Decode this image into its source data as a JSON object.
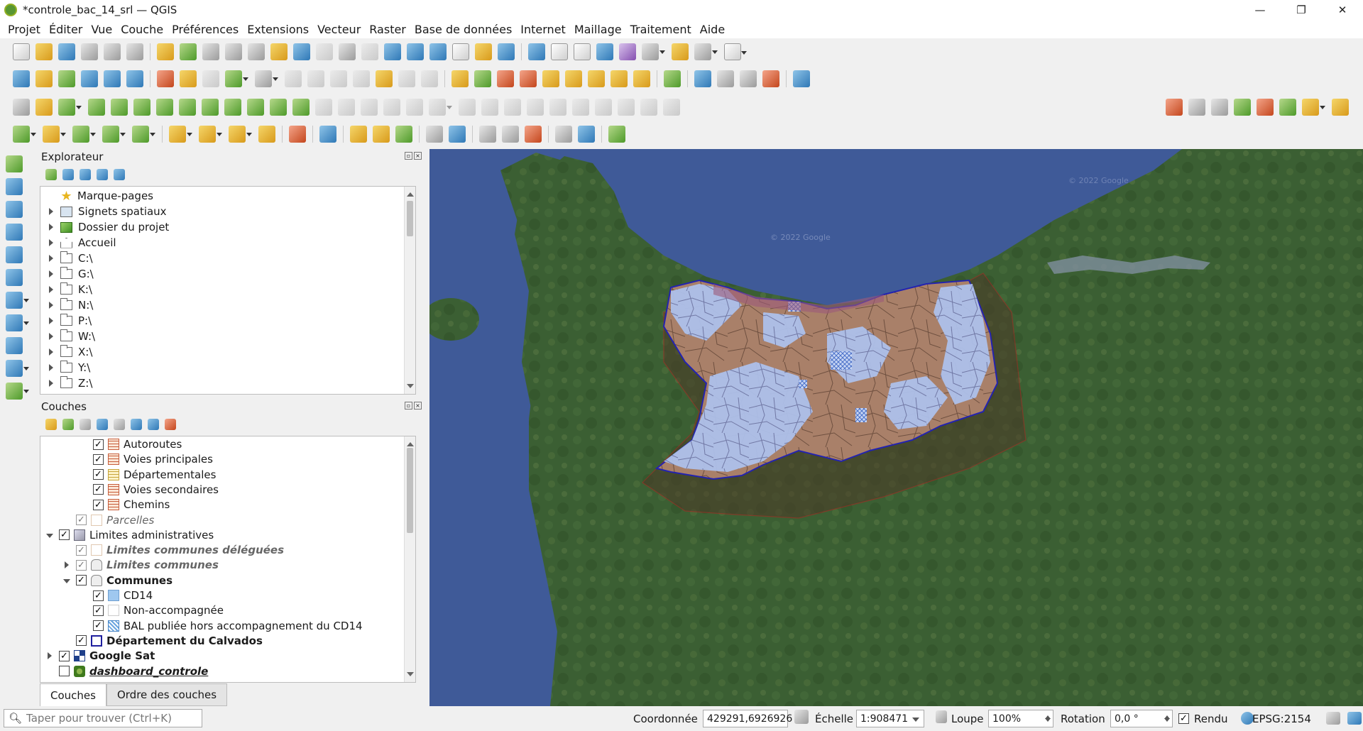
{
  "window": {
    "title": "*controle_bac_14_srl — QGIS",
    "controls": [
      "—",
      "❐",
      "✕"
    ]
  },
  "menu": [
    "Projet",
    "Éditer",
    "Vue",
    "Couche",
    "Préférences",
    "Extensions",
    "Vecteur",
    "Raster",
    "Base de données",
    "Internet",
    "Maillage",
    "Traitement",
    "Aide"
  ],
  "explorer": {
    "title": "Explorateur",
    "items": [
      {
        "label": "Marque-pages",
        "icon": "star-icon",
        "expand": false
      },
      {
        "label": "Signets spatiaux",
        "icon": "bookmark-icon",
        "expand": true
      },
      {
        "label": "Dossier du projet",
        "icon": "project-folder-icon",
        "expand": true
      },
      {
        "label": "Accueil",
        "icon": "home-icon",
        "expand": true
      },
      {
        "label": "C:\\",
        "icon": "folder-icon",
        "expand": true
      },
      {
        "label": "G:\\",
        "icon": "folder-icon",
        "expand": true
      },
      {
        "label": "K:\\",
        "icon": "folder-icon",
        "expand": true
      },
      {
        "label": "N:\\",
        "icon": "folder-icon",
        "expand": true
      },
      {
        "label": "P:\\",
        "icon": "folder-icon",
        "expand": true
      },
      {
        "label": "W:\\",
        "icon": "folder-icon",
        "expand": true
      },
      {
        "label": "X:\\",
        "icon": "folder-icon",
        "expand": true
      },
      {
        "label": "Y:\\",
        "icon": "folder-icon",
        "expand": true
      },
      {
        "label": "Z:\\",
        "icon": "folder-icon",
        "expand": true
      }
    ]
  },
  "layers": {
    "title": "Couches",
    "items": [
      {
        "label": "Autoroutes",
        "checked": true,
        "sym": "sym-road",
        "indent": 3,
        "style": "",
        "arrow": ""
      },
      {
        "label": "Voies principales",
        "checked": true,
        "sym": "sym-road",
        "indent": 3,
        "style": "",
        "arrow": ""
      },
      {
        "label": "Départementales",
        "checked": true,
        "sym": "sym-road2",
        "indent": 3,
        "style": "",
        "arrow": ""
      },
      {
        "label": "Voies secondaires",
        "checked": true,
        "sym": "sym-road",
        "indent": 3,
        "style": "",
        "arrow": ""
      },
      {
        "label": "Chemins",
        "checked": true,
        "sym": "sym-road",
        "indent": 3,
        "style": "",
        "arrow": ""
      },
      {
        "label": "Parcelles",
        "checked": true,
        "sym": "sym-empty",
        "indent": 2,
        "style": "italic",
        "arrow": "",
        "grey": true
      },
      {
        "label": "Limites administratives",
        "checked": true,
        "sym": "sym-group",
        "indent": 1,
        "style": "",
        "arrow": "down"
      },
      {
        "label": "Limites communes déléguées",
        "checked": true,
        "sym": "sym-empty",
        "indent": 2,
        "style": "italic bold",
        "arrow": "",
        "grey": true
      },
      {
        "label": "Limites communes",
        "checked": true,
        "sym": "sym-poly",
        "indent": 2,
        "style": "italic bold",
        "arrow": "right",
        "grey": true
      },
      {
        "label": "Communes",
        "checked": true,
        "sym": "sym-poly",
        "indent": 2,
        "style": "bold",
        "arrow": "down"
      },
      {
        "label": "CD14",
        "checked": true,
        "sym": "sym-cd14",
        "indent": 3,
        "style": "",
        "arrow": ""
      },
      {
        "label": "Non-accompagnée",
        "checked": true,
        "sym": "sym-na",
        "indent": 3,
        "style": "",
        "arrow": ""
      },
      {
        "label": "BAL publiée hors accompagnement du CD14",
        "checked": true,
        "sym": "sym-hatch",
        "indent": 3,
        "style": "",
        "arrow": ""
      },
      {
        "label": "Département du Calvados",
        "checked": true,
        "sym": "sym-dept",
        "indent": 2,
        "style": "bold",
        "arrow": ""
      },
      {
        "label": "Google Sat",
        "checked": true,
        "sym": "sym-sat",
        "indent": 1,
        "style": "bold",
        "arrow": "right"
      },
      {
        "label": "dashboard_controle",
        "checked": false,
        "sym": "sym-dash",
        "indent": 1,
        "style": "bold-italic",
        "arrow": ""
      }
    ]
  },
  "tabs": {
    "layers": "Couches",
    "order": "Ordre des couches"
  },
  "status": {
    "search_placeholder": "Taper pour trouver (Ctrl+K)",
    "coord_label": "Coordonnée",
    "coord_value": "429291,6926926",
    "scale_label": "Échelle",
    "scale_value": "1:908471",
    "magnifier_label": "Loupe",
    "magnifier_value": "100%",
    "rotation_label": "Rotation",
    "rotation_value": "0,0 °",
    "render_label": "Rendu",
    "crs": "EPSG:2154"
  },
  "map": {
    "watermark": "© 2022 Google",
    "colors": {
      "sea": "#3f5a98",
      "land": "#3a5e33",
      "communes_fill": "#a57a62",
      "cd14_fill": "#a9bde6",
      "dept_outline": "#2323b0",
      "buffer": "#c0392b"
    }
  }
}
